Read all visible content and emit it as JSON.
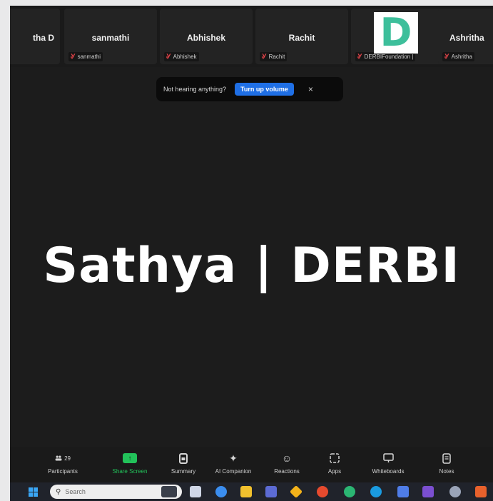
{
  "participants": [
    {
      "name": "tha D",
      "label": ""
    },
    {
      "name": "sanmathi",
      "label": "sanmathi"
    },
    {
      "name": "Abhishek",
      "label": "Abhishek"
    },
    {
      "name": "Rachit",
      "label": "Rachit"
    },
    {
      "name": "",
      "label": "DERBIFoundation |"
    },
    {
      "name": "Ashritha",
      "label": "Ashritha"
    }
  ],
  "avatar_letter": "D",
  "notice": {
    "text": "Not hearing anything?",
    "button": "Turn up volume",
    "close": "×"
  },
  "speaker_name": "Sathya | DERBI",
  "toolbar": {
    "participants_label": "Participants",
    "participants_count": "29",
    "share_label": "Share Screen",
    "summary_label": "Summary",
    "ai_label": "AI Companion",
    "reactions_label": "Reactions",
    "apps_label": "Apps",
    "whiteboards_label": "Whiteboards",
    "notes_label": "Notes"
  },
  "taskbar": {
    "search_placeholder": "Search"
  },
  "colors": {
    "share_green": "#22c25a",
    "accent_blue": "#1f6fe5",
    "avatar_teal": "#3dbf9b",
    "mic_off_red": "#e8444a"
  }
}
